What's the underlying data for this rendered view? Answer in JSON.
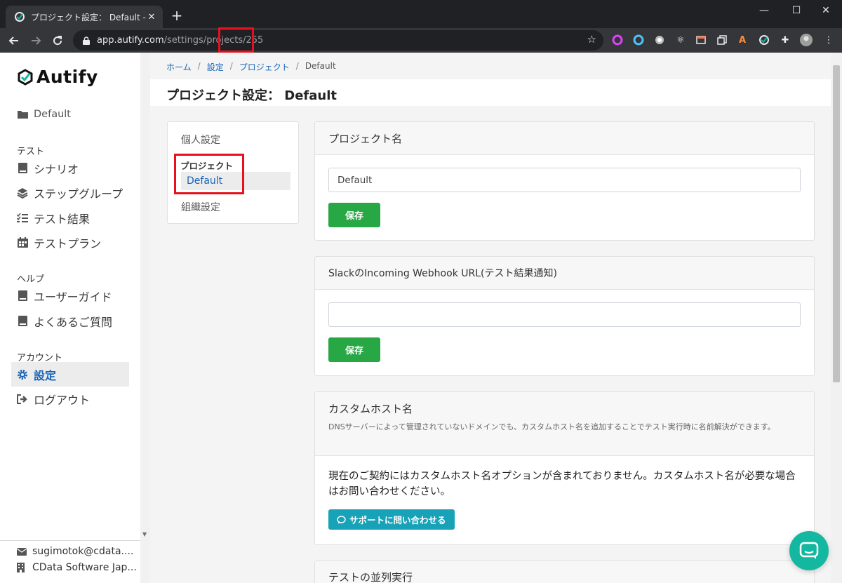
{
  "browser": {
    "tab_title": "プロジェクト設定： Default - Autify",
    "tab_close": "✕",
    "new_tab": "+",
    "url_host": "app.autify.com",
    "url_path": "/settings/projects/255",
    "window_min": "—",
    "window_max": "☐",
    "window_close": "✕"
  },
  "sidebar": {
    "brand": "Autify",
    "project": "Default",
    "sections": {
      "test": "テスト",
      "help": "ヘルプ",
      "account": "アカウント"
    },
    "items": {
      "scenario": "シナリオ",
      "step_group": "ステップグループ",
      "test_results": "テスト結果",
      "test_plan": "テストプラン",
      "user_guide": "ユーザーガイド",
      "faq": "よくあるご質問",
      "settings": "設定",
      "logout": "ログアウト"
    },
    "footer": {
      "email": "sugimotok@cdata....",
      "org": "CData Software Jap..."
    }
  },
  "breadcrumb": {
    "home": "ホーム",
    "settings": "設定",
    "project": "プロジェクト",
    "current": "Default",
    "sep": "/"
  },
  "page": {
    "title": "プロジェクト設定： Default"
  },
  "subnav": {
    "personal": "個人設定",
    "project_group": "プロジェクト",
    "project_active": "Default",
    "org": "組織設定"
  },
  "cards": {
    "project_name": {
      "title": "プロジェクト名",
      "value": "Default",
      "save": "保存"
    },
    "slack": {
      "title": "SlackのIncoming Webhook URL(テスト結果通知)",
      "value": "",
      "save": "保存"
    },
    "custom_host": {
      "title": "カスタムホスト名",
      "subtitle": "DNSサーバーによって管理されていないドメインでも、カスタムホスト名を追加することでテスト実行時に名前解決ができます。",
      "body": "現在のご契約にはカスタムホスト名オプションが含まれておりません。カスタムホスト名が必要な場合はお問い合わせください。",
      "support_button": "サポートに問い合わせる"
    },
    "parallel": {
      "title": "テストの並列実行"
    }
  },
  "colors": {
    "accent": "#1864b8",
    "save_green": "#28a745",
    "support_teal": "#17a2b8",
    "chat_teal": "#14b8a0",
    "highlight_red": "#e8101e"
  }
}
